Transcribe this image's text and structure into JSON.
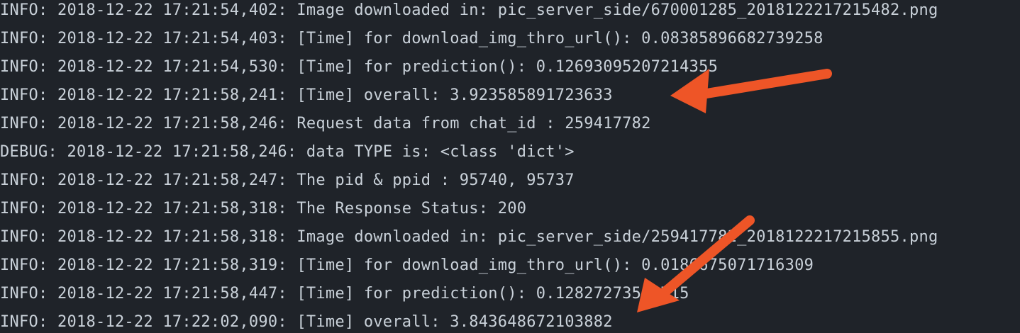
{
  "terminal": {
    "lines": [
      "INFO: 2018-12-22 17:21:54,402: Image downloaded in: pic_server_side/670001285_2018122217215482.png",
      "INFO: 2018-12-22 17:21:54,403: [Time] for download_img_thro_url(): 0.08385896682739258",
      "INFO: 2018-12-22 17:21:54,530: [Time] for prediction(): 0.12693095207214355",
      "INFO: 2018-12-22 17:21:58,241: [Time] overall: 3.923585891723633",
      "INFO: 2018-12-22 17:21:58,246: Request data from chat_id : 259417782",
      "DEBUG: 2018-12-22 17:21:58,246: data TYPE is: <class 'dict'>",
      "INFO: 2018-12-22 17:21:58,247: The pid & ppid : 95740, 95737",
      "INFO: 2018-12-22 17:21:58,318: The Response Status: 200",
      "INFO: 2018-12-22 17:21:58,318: Image downloaded in: pic_server_side/259417782_2018122217215855.png",
      "INFO: 2018-12-22 17:21:58,319: [Time] for download_img_thro_url(): 0.0186675071716309",
      "INFO: 2018-12-22 17:21:58,447: [Time] for prediction(): 0.12827273532715",
      "INFO: 2018-12-22 17:22:02,090: [Time] overall: 3.843648672103882"
    ]
  },
  "annotations": {
    "arrow_color": "#ee5527"
  }
}
